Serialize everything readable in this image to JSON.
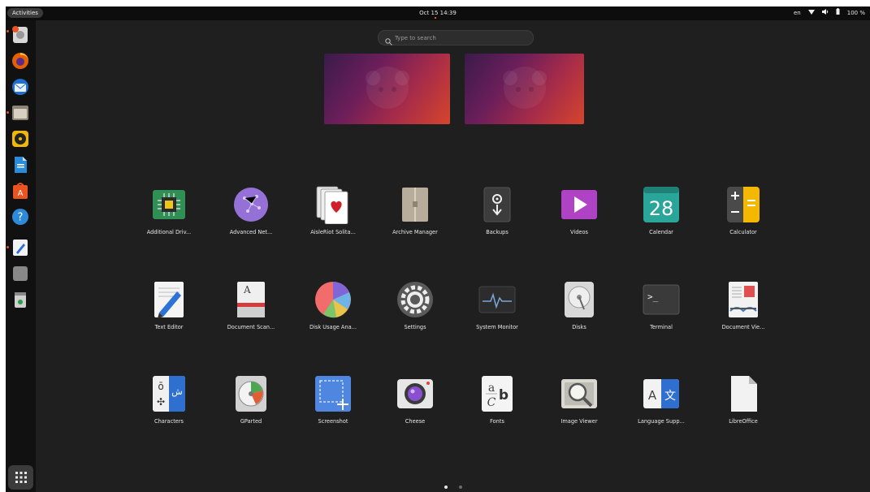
{
  "topbar": {
    "activities_label": "Activities",
    "clock": "Oct 15  14:39",
    "keyboard_layout": "en",
    "battery": "100 %"
  },
  "search": {
    "placeholder": "Type to search"
  },
  "dock": {
    "items": [
      {
        "icon": "disk-update-icon"
      },
      {
        "icon": "firefox-icon"
      },
      {
        "icon": "thunderbird-icon"
      },
      {
        "icon": "files-icon"
      },
      {
        "icon": "rhythmbox-icon"
      },
      {
        "icon": "writer-icon"
      },
      {
        "icon": "software-store-icon"
      },
      {
        "icon": "help-icon"
      },
      {
        "icon": "text-editor-icon"
      },
      {
        "icon": "blank-window-icon"
      },
      {
        "icon": "trash-icon"
      }
    ],
    "show_apps_icon": "grid-icon"
  },
  "apps": [
    {
      "label": "Additional Driv..."
    },
    {
      "label": "Advanced Net..."
    },
    {
      "label": "AisleRiot Solita..."
    },
    {
      "label": "Archive Manager"
    },
    {
      "label": "Backups"
    },
    {
      "label": "Videos"
    },
    {
      "label": "Calendar",
      "icon_text": "28"
    },
    {
      "label": "Calculator"
    },
    {
      "label": "Text Editor"
    },
    {
      "label": "Document Scan..."
    },
    {
      "label": "Disk Usage Ana..."
    },
    {
      "label": "Settings"
    },
    {
      "label": "System Monitor"
    },
    {
      "label": "Disks"
    },
    {
      "label": "Terminal",
      "icon_text": ">_"
    },
    {
      "label": "Document Vie..."
    },
    {
      "label": "Characters"
    },
    {
      "label": "GParted"
    },
    {
      "label": "Screenshot"
    },
    {
      "label": "Cheese"
    },
    {
      "label": "Fonts"
    },
    {
      "label": "Image Viewer"
    },
    {
      "label": "Language Supp..."
    },
    {
      "label": "LibreOffice"
    }
  ],
  "colors": {
    "accent": "#e95420",
    "background": "#1f1f1f",
    "topbar": "#0d0d0d"
  }
}
